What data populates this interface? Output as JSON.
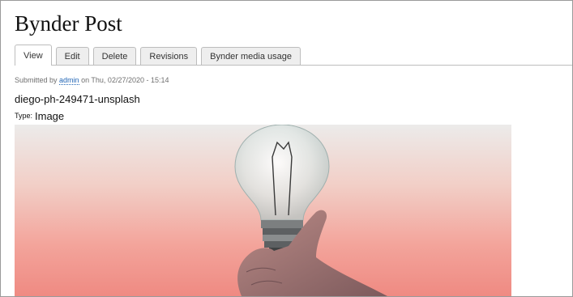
{
  "page": {
    "title": "Bynder Post"
  },
  "tabs": [
    {
      "label": "View",
      "active": true
    },
    {
      "label": "Edit",
      "active": false
    },
    {
      "label": "Delete",
      "active": false
    },
    {
      "label": "Revisions",
      "active": false
    },
    {
      "label": "Bynder media usage",
      "active": false
    }
  ],
  "meta": {
    "submitted_prefix": "Submitted by",
    "author": "admin",
    "submitted_suffix": "on Thu, 02/27/2020 - 15:14"
  },
  "media": {
    "name": "diego-ph-249471-unsplash",
    "type_label": "Type:",
    "type_value": "Image",
    "image_subject": "light-bulb-in-hand"
  },
  "colors": {
    "link": "#2467b6",
    "tab_bg": "#eeeeee",
    "border": "#bdbdbd"
  }
}
